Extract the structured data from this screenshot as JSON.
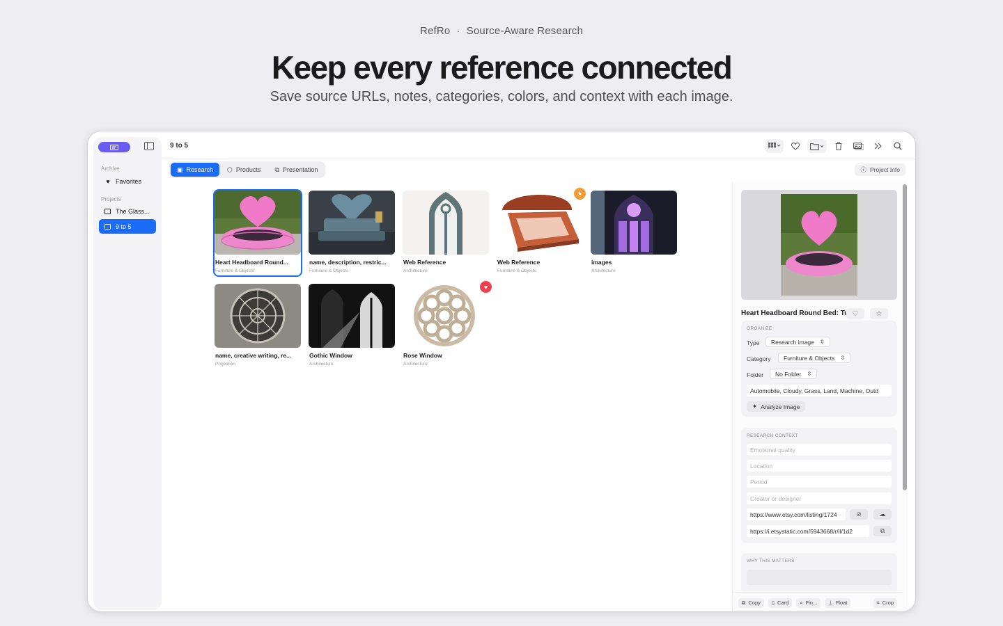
{
  "hero": {
    "brand": "RefRo",
    "separator": "·",
    "tagline": "Source-Aware Research",
    "title": "Keep every reference connected",
    "subtitle": "Save source URLs, notes, categories, colors, and context with each image."
  },
  "sidebar": {
    "archive_label": "Archive",
    "favorites_label": "Favorites",
    "projects_label": "Projects",
    "projects": [
      {
        "label": "The Glass..."
      },
      {
        "label": "9 to 5"
      }
    ]
  },
  "topbar": {
    "breadcrumb": "9 to 5"
  },
  "tabs": [
    {
      "label": "Research"
    },
    {
      "label": "Products"
    },
    {
      "label": "Presentation"
    }
  ],
  "project_info_label": "Project Info",
  "grid": {
    "items": [
      {
        "title": "Heart Headboard Round...",
        "category": "Furniture & Objects"
      },
      {
        "title": "name, description, restric...",
        "category": "Furniture & Objects"
      },
      {
        "title": "Web Reference",
        "category": "Architecture"
      },
      {
        "title": "Web Reference",
        "category": "Furniture & Objects"
      },
      {
        "title": "images",
        "category": "Architecture"
      },
      {
        "title": "name, creative writing, re...",
        "category": "Projection"
      },
      {
        "title": "Gothic Window",
        "category": "Architecture"
      },
      {
        "title": "Rose Window",
        "category": "Architecture"
      }
    ]
  },
  "inspector": {
    "title": "Heart Headboard Round Bed: Tu",
    "organize": {
      "header": "ORGANIZE",
      "type_label": "Type",
      "type_value": "Research image",
      "category_label": "Category",
      "category_value": "Furniture & Objects",
      "folder_label": "Folder",
      "folder_value": "No Folder",
      "tags": "Automobile, Cloudy, Grass, Land, Machine, Outd",
      "analyze_label": "Analyze Image"
    },
    "research": {
      "header": "RESEARCH CONTEXT",
      "emotional_placeholder": "Emotional quality",
      "location_placeholder": "Location",
      "period_placeholder": "Period",
      "creator_placeholder": "Creator or designer",
      "url1": "https://www.etsy.com/listing/1724",
      "url2": "https://i.etsystatic.com/5943668/r/il/1d2"
    },
    "why": {
      "header": "WHY THIS MATTERS"
    },
    "footer": {
      "copy": "Copy",
      "card": "Card",
      "find": "Fin...",
      "float": "Float",
      "crop": "Crop"
    }
  },
  "colors": {
    "accent": "#1a6cf5",
    "brand_pill": "#6a5cf0",
    "star_badge": "#f29a36",
    "heart_badge": "#ef4050"
  }
}
